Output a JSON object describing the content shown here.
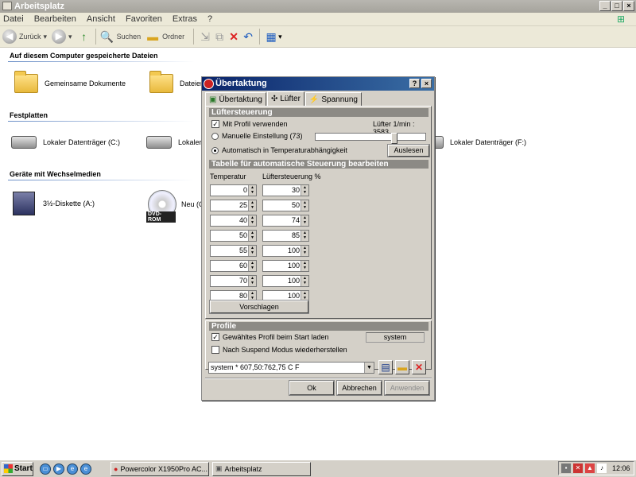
{
  "window": {
    "title": "Arbeitsplatz"
  },
  "menu": [
    "Datei",
    "Bearbeiten",
    "Ansicht",
    "Favoriten",
    "Extras",
    "?"
  ],
  "toolbar": {
    "back": "Zurück",
    "search": "Suchen",
    "folders": "Ordner"
  },
  "explorer": {
    "group_stored": "Auf diesem Computer gespeicherte Dateien",
    "item_shared": "Gemeinsame Dokumente",
    "item_files": "Dateien",
    "group_disks": "Festplatten",
    "drive_c": "Lokaler Datenträger (C:)",
    "drive_d": "Lokaler",
    "drive_f": "Lokaler Datenträger (F:)",
    "group_removable": "Geräte mit Wechselmedien",
    "floppy": "3½-Diskette (A:)",
    "dvd": "Neu (G:)",
    "dvd_label": "DVD-ROM"
  },
  "dialog": {
    "title": "Übertaktung",
    "tabs": [
      "Übertaktung",
      "Lüfter",
      "Spannung"
    ],
    "active_tab": 1,
    "fan": {
      "section": "Lüftersteuerung",
      "use_profile": "Mit Profil verwenden",
      "use_profile_checked": true,
      "rpm": "Lüfter 1/min : 3583",
      "manual": "Manuelle Einstellung (73)",
      "manual_level": 0.73,
      "auto": "Automatisch in Temperaturabhängigkeit",
      "read_btn": "Auslesen"
    },
    "table": {
      "section": "Tabelle für automatische Steuerung bearbeiten",
      "col_temp": "Temperatur",
      "col_fan": "Lüftersteuerung %",
      "rows": [
        {
          "temp": "0",
          "fan": "30"
        },
        {
          "temp": "25",
          "fan": "50"
        },
        {
          "temp": "40",
          "fan": "74"
        },
        {
          "temp": "50",
          "fan": "85"
        },
        {
          "temp": "55",
          "fan": "100"
        },
        {
          "temp": "60",
          "fan": "100"
        },
        {
          "temp": "70",
          "fan": "100"
        },
        {
          "temp": "80",
          "fan": "100"
        }
      ],
      "suggest_btn": "Vorschlagen"
    },
    "profile": {
      "section": "Profile",
      "load_on_start": "Gewähltes Profil beim Start laden",
      "load_on_start_checked": true,
      "profile_name": "system",
      "restore_suspend": "Nach Suspend Modus wiederherstellen",
      "restore_suspend_checked": false,
      "selected": "system * 607,50:762,75 C F"
    },
    "buttons": {
      "ok": "Ok",
      "cancel": "Abbrechen",
      "apply": "Anwenden"
    }
  },
  "taskbar": {
    "start": "Start",
    "task1": "Powercolor X1950Pro AC...",
    "task2": "Arbeitsplatz",
    "clock": "12:06"
  }
}
